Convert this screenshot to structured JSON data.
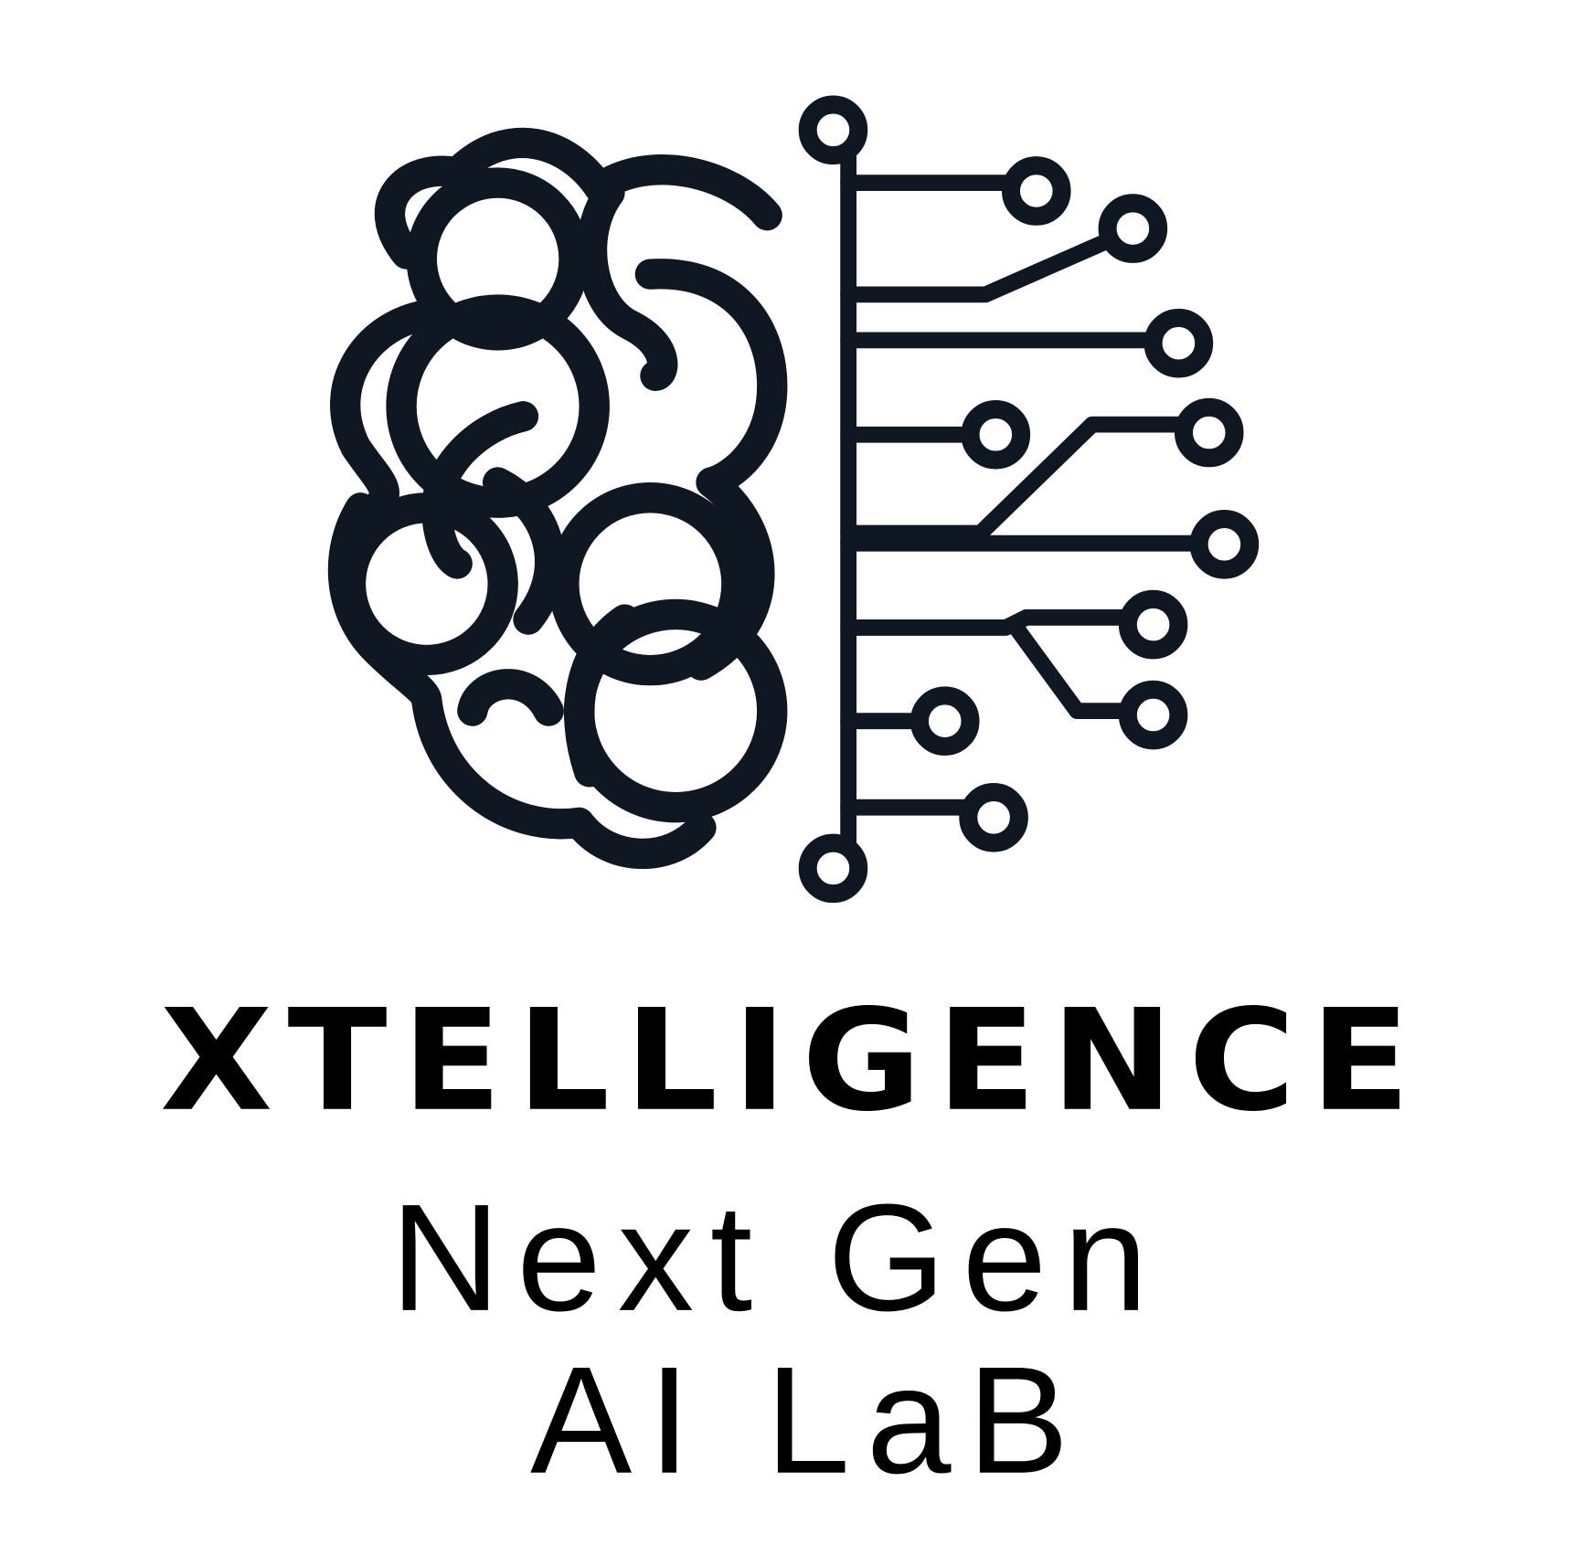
{
  "logo": {
    "brand_name": "XTELLIGENCE",
    "tagline_line1": "Next Gen",
    "tagline_line2": "AI LaB",
    "icon": "brain-circuit-icon",
    "ink_color": "#0f1722",
    "background_color": "#ffffff"
  }
}
